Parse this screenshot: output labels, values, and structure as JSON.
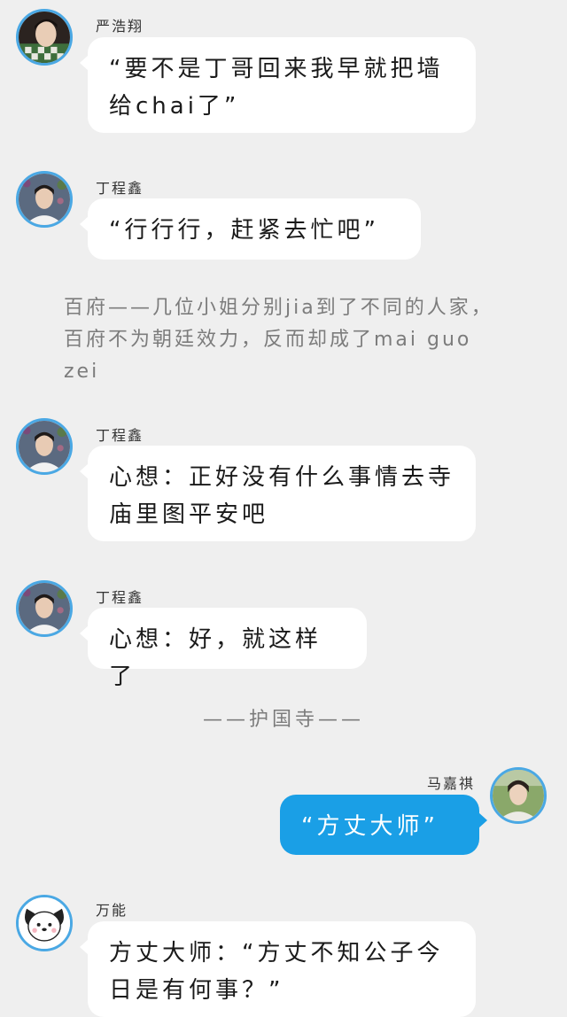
{
  "messages": [
    {
      "sender": "严浩翔",
      "text": "“要不是丁哥回来我早就把墙给chai了”",
      "avatar_icon": "portrait-yan-avatar"
    },
    {
      "sender": "丁程鑫",
      "text": "“行行行，赶紧去忙吧”",
      "avatar_icon": "portrait-ding-avatar"
    },
    {
      "sender": "丁程鑫",
      "text": "心想：正好没有什么事情去寺庙里图平安吧",
      "avatar_icon": "portrait-ding-avatar"
    },
    {
      "sender": "丁程鑫",
      "text": "心想：好，就这样了",
      "avatar_icon": "portrait-ding-avatar"
    },
    {
      "sender": "马嘉祺",
      "text": "“方丈大师”",
      "avatar_icon": "portrait-ma-avatar"
    },
    {
      "sender": "万能",
      "text": "方丈大师：“方丈不知公子今日是有何事？”",
      "avatar_icon": "pochacco-dog-avatar"
    }
  ],
  "narration": "百府——几位小姐分别jia到了不同的人家，百府不为朝廷效力，反而却成了mai guo zei",
  "divider": "——护国寺——",
  "colors": {
    "background": "#efefef",
    "bubble_left": "#ffffff",
    "bubble_right": "#1a9fe6",
    "avatar_ring": "#4aa8e4",
    "narration_text": "#7c7c7c"
  }
}
